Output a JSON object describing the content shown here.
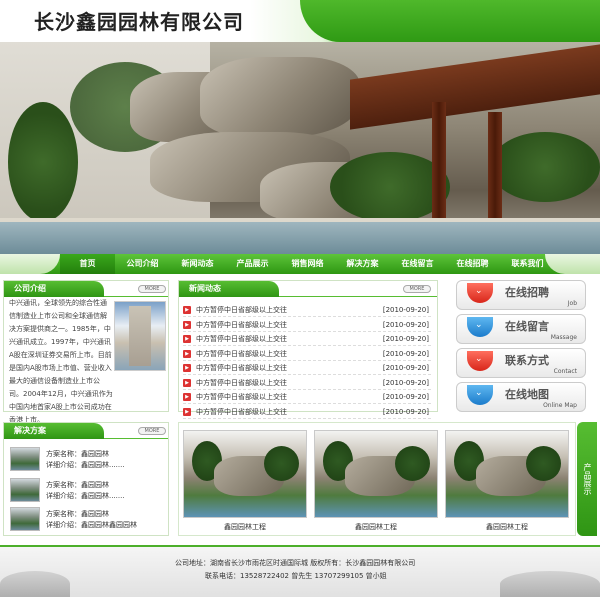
{
  "header": {
    "title": "长沙鑫园园林有限公司"
  },
  "nav": {
    "items": [
      "首页",
      "公司介绍",
      "新闻动态",
      "产品展示",
      "销售网络",
      "解决方案",
      "在线留言",
      "在线招聘",
      "联系我们"
    ]
  },
  "intro": {
    "title": "公司介绍",
    "more": "MORE",
    "text": "中兴通讯，全球领先的综合性通信制造业上市公司和全球通信解决方案提供商之一。1985年，中兴通讯成立。1997年，中兴通讯A股在深圳证券交易所上市。目前是国内A股市场上市值、营业收入最大的通信设备制造业上市公司。2004年12月，中兴通讯作为中国内地首家A股上市公司成功在香港上市。"
  },
  "news": {
    "title": "新闻动态",
    "more": "MORE",
    "items": [
      {
        "title": "中方暂停中日省部级以上交往",
        "date": "[2010-09-20]"
      },
      {
        "title": "中方暂停中日省部级以上交往",
        "date": "[2010-09-20]"
      },
      {
        "title": "中方暂停中日省部级以上交往",
        "date": "[2010-09-20]"
      },
      {
        "title": "中方暂停中日省部级以上交往",
        "date": "[2010-09-20]"
      },
      {
        "title": "中方暂停中日省部级以上交往",
        "date": "[2010-09-20]"
      },
      {
        "title": "中方暂停中日省部级以上交往",
        "date": "[2010-09-20]"
      },
      {
        "title": "中方暂停中日省部级以上交往",
        "date": "[2010-09-20]"
      },
      {
        "title": "中方暂停中日省部级以上交往",
        "date": "[2010-09-20]"
      }
    ]
  },
  "quick": [
    {
      "cn": "在线招聘",
      "en": "Job",
      "color": "red",
      "icon": "chevron-down-icon"
    },
    {
      "cn": "在线留言",
      "en": "Massage",
      "color": "blue",
      "icon": "chevron-down-icon"
    },
    {
      "cn": "联系方式",
      "en": "Contact",
      "color": "red",
      "icon": "chevron-down-icon"
    },
    {
      "cn": "在线地图",
      "en": "Online Map",
      "color": "blue",
      "icon": "chevron-down-icon"
    }
  ],
  "solutions": {
    "title": "解决方案",
    "more": "MORE",
    "items": [
      {
        "name": "方案名称：鑫园园林",
        "detail": "详细介绍：鑫园园林......."
      },
      {
        "name": "方案名称：鑫园园林",
        "detail": "详细介绍：鑫园园林......."
      },
      {
        "name": "方案名称：鑫园园林",
        "detail": "详细介绍：鑫园园林鑫园园林"
      }
    ]
  },
  "products": {
    "side_label": "产品展示",
    "items": [
      {
        "caption": "鑫园园林工程"
      },
      {
        "caption": "鑫园园林工程"
      },
      {
        "caption": "鑫园园林工程"
      }
    ]
  },
  "footer": {
    "line1": "公司地址：湖南省长沙市雨花区时通国际城   版权所有：长沙鑫园园林有限公司",
    "line2": "联系电话：13528722402   曾先生     13707299105   曾小姐"
  }
}
